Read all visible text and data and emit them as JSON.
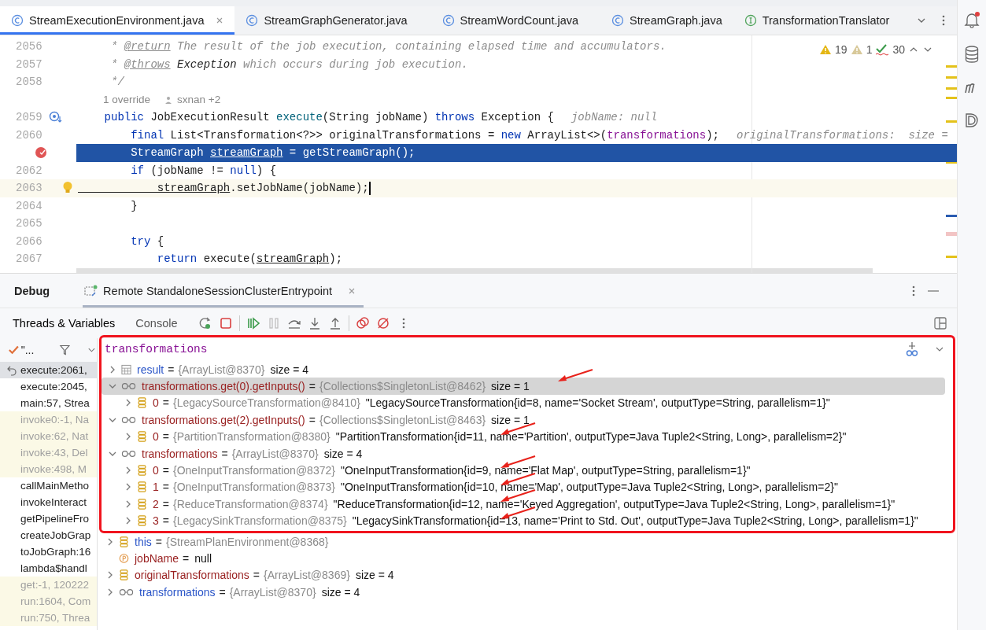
{
  "editor_tabs": [
    {
      "label": "StreamExecutionEnvironment.java",
      "kind": "class",
      "selected": true
    },
    {
      "label": "StreamGraphGenerator.java",
      "kind": "class",
      "selected": false
    },
    {
      "label": "StreamWordCount.java",
      "kind": "class",
      "selected": false
    },
    {
      "label": "StreamGraph.java",
      "kind": "class",
      "selected": false
    },
    {
      "label": "TransformationTranslator",
      "kind": "interface",
      "selected": false
    }
  ],
  "inspections": {
    "warnings": "19",
    "weak_warnings": "1",
    "typos": "30"
  },
  "editor_lines": [
    {
      "number": "2056",
      "segments": [
        {
          "kind": "comment",
          "text": "     * "
        },
        {
          "kind": "doctag",
          "text": "@return"
        },
        {
          "kind": "comment",
          "text": " The result of the job execution, containing elapsed time and accumulators."
        }
      ]
    },
    {
      "number": "2057",
      "segments": [
        {
          "kind": "comment",
          "text": "     * "
        },
        {
          "kind": "doctag",
          "text": "@throws"
        },
        {
          "kind": "italic",
          "text": " Exception"
        },
        {
          "kind": "comment",
          "text": " which occurs during job execution."
        }
      ]
    },
    {
      "number": "2058",
      "segments": [
        {
          "kind": "comment",
          "text": "     */"
        }
      ]
    },
    {
      "kind": "inlay",
      "overrides": "1 override",
      "authors": "sxnan +2"
    },
    {
      "number": "2059",
      "has_override": true,
      "segments": [
        {
          "kind": "kw",
          "text": "    public"
        },
        {
          "kind": "plain",
          "text": " JobExecutionResult "
        },
        {
          "kind": "method",
          "text": "execute"
        },
        {
          "kind": "plain",
          "text": "(String jobName) "
        },
        {
          "kind": "kw",
          "text": "throws"
        },
        {
          "kind": "plain",
          "text": " Exception {"
        }
      ],
      "hint": "jobName: null"
    },
    {
      "number": "2060",
      "segments": [
        {
          "kind": "kw",
          "text": "        final"
        },
        {
          "kind": "plain",
          "text": " List<Transformation<?>> originalTransformations = "
        },
        {
          "kind": "kw",
          "text": "new"
        },
        {
          "kind": "plain",
          "text": " ArrayList<>("
        },
        {
          "kind": "field",
          "text": "transformations"
        },
        {
          "kind": "plain",
          "text": ");"
        }
      ],
      "hint": "originalTransformations:  size ="
    },
    {
      "breakpoint": true,
      "current": true,
      "segments": [
        {
          "kind": "plain",
          "text": "        StreamGraph "
        },
        {
          "kind": "ul",
          "text": "streamGraph"
        },
        {
          "kind": "plain",
          "text": " = getStreamGraph();"
        }
      ]
    },
    {
      "number": "2062",
      "segments": [
        {
          "kind": "kw",
          "text": "        if"
        },
        {
          "kind": "plain",
          "text": " (jobName != "
        },
        {
          "kind": "kw",
          "text": "null"
        },
        {
          "kind": "plain",
          "text": ") {"
        }
      ]
    },
    {
      "number": "2063",
      "intention": true,
      "caret": true,
      "segments": [
        {
          "kind": "ul",
          "text": "            streamGraph"
        },
        {
          "kind": "plain",
          "text": ".setJobName(jobName);"
        }
      ]
    },
    {
      "number": "2064",
      "segments": [
        {
          "kind": "plain",
          "text": "        }"
        }
      ]
    },
    {
      "number": "2065"
    },
    {
      "number": "2066",
      "segments": [
        {
          "kind": "kw",
          "text": "        try"
        },
        {
          "kind": "plain",
          "text": " {"
        }
      ]
    },
    {
      "number": "2067",
      "segments": [
        {
          "kind": "kw",
          "text": "            return"
        },
        {
          "kind": "plain",
          "text": " execute("
        },
        {
          "kind": "ul",
          "text": "streamGraph"
        },
        {
          "kind": "plain",
          "text": ");"
        }
      ]
    }
  ],
  "debug": {
    "title": "Debug",
    "session": "Remote StandaloneSessionClusterEntrypoint",
    "tabs": [
      {
        "label": "Threads & Variables",
        "selected": true
      },
      {
        "label": "Console",
        "selected": false
      }
    ],
    "thread": "\"..."
  },
  "frames": [
    {
      "label": "execute:2061,",
      "library": false,
      "selected": true
    },
    {
      "label": "execute:2045,",
      "library": false,
      "selected": false
    },
    {
      "label": "main:57, Strea",
      "library": false,
      "selected": false
    },
    {
      "label": "invoke0:-1, Na",
      "library": true,
      "selected": false
    },
    {
      "label": "invoke:62, Nat",
      "library": true,
      "selected": false
    },
    {
      "label": "invoke:43, Del",
      "library": true,
      "selected": false
    },
    {
      "label": "invoke:498, M",
      "library": true,
      "selected": false
    },
    {
      "label": "callMainMetho",
      "library": false,
      "selected": false
    },
    {
      "label": "invokeInteract",
      "library": false,
      "selected": false
    },
    {
      "label": "getPipelineFro",
      "library": false,
      "selected": false
    },
    {
      "label": "createJobGrap",
      "library": false,
      "selected": false
    },
    {
      "label": "toJobGraph:16",
      "library": false,
      "selected": false
    },
    {
      "label": "lambda$handl",
      "library": false,
      "selected": false
    },
    {
      "label": "get:-1, 120222",
      "library": true,
      "selected": false
    },
    {
      "label": "run:1604, Com",
      "library": true,
      "selected": false
    },
    {
      "label": "run:750, Threa",
      "library": true,
      "selected": false
    }
  ],
  "watches": {
    "expression": "transformations",
    "outlined": true,
    "items": [
      {
        "name": "result",
        "kind": "result",
        "op": "=",
        "type": "{ArrayList@8370}",
        "value": "size = 4",
        "expanded": false,
        "selected": false,
        "arrow": false
      },
      {
        "name": "transformations.get(0).getInputs()",
        "kind": "watch",
        "op": "=",
        "type": "{Collections$SingletonList@8462}",
        "value": "size = 1",
        "expanded": true,
        "selected": true,
        "arrow": true,
        "children": [
          {
            "name": "0",
            "kind": "element",
            "op": "=",
            "type": "{LegacySourceTransformation@8410}",
            "value": "\"LegacySourceTransformation{id=8, name='Socket Stream', outputType=String, parallelism=1}\"",
            "expanded": false,
            "selected": false,
            "arrow": false
          }
        ]
      },
      {
        "name": "transformations.get(2).getInputs()",
        "kind": "watch",
        "op": "=",
        "type": "{Collections$SingletonList@8463}",
        "value": "size = 1",
        "expanded": true,
        "selected": false,
        "arrow": false,
        "children": [
          {
            "name": "0",
            "kind": "element",
            "op": "=",
            "type": "{PartitionTransformation@8380}",
            "value": "\"PartitionTransformation{id=11, name='Partition', outputType=Java Tuple2<String, Long>, parallelism=2}\"",
            "expanded": false,
            "selected": false,
            "arrow": true
          }
        ]
      },
      {
        "name": "transformations",
        "kind": "watch",
        "op": "=",
        "type": "{ArrayList@8370}",
        "value": "size = 4",
        "expanded": true,
        "selected": false,
        "arrow": false,
        "children": [
          {
            "name": "0",
            "kind": "element",
            "op": "=",
            "type": "{OneInputTransformation@8372}",
            "value": "\"OneInputTransformation{id=9, name='Flat Map', outputType=String, parallelism=1}\"",
            "expanded": false,
            "selected": false,
            "arrow": true
          },
          {
            "name": "1",
            "kind": "element",
            "op": "=",
            "type": "{OneInputTransformation@8373}",
            "value": "\"OneInputTransformation{id=10, name='Map', outputType=Java Tuple2<String, Long>, parallelism=2}\"",
            "expanded": false,
            "selected": false,
            "arrow": true
          },
          {
            "name": "2",
            "kind": "element",
            "op": "=",
            "type": "{ReduceTransformation@8374}",
            "value": "\"ReduceTransformation{id=12, name='Keyed Aggregation', outputType=Java Tuple2<String, Long>, parallelism=1}\"",
            "expanded": false,
            "selected": false,
            "arrow": true
          },
          {
            "name": "3",
            "kind": "element",
            "op": "=",
            "type": "{LegacySinkTransformation@8375}",
            "value": "\"LegacySinkTransformation{id=13, name='Print to Std. Out', outputType=Java Tuple2<String, Long>, parallelism=1}\"",
            "expanded": false,
            "selected": false,
            "arrow": true
          }
        ]
      }
    ]
  },
  "variables": [
    {
      "name": "this",
      "kind": "object",
      "op": "=",
      "type": "{StreamPlanEnvironment@8368}",
      "expandable": true
    },
    {
      "name": "jobName",
      "kind": "parameter",
      "op": "=",
      "value": "null",
      "expandable": false
    },
    {
      "name": "originalTransformations",
      "kind": "local",
      "op": "=",
      "type": "{ArrayList@8369}",
      "value": "size = 4",
      "expandable": true
    },
    {
      "name": "transformations",
      "kind": "field",
      "op": "=",
      "type": "{ArrayList@8370}",
      "value": "size = 4",
      "expandable": true
    }
  ]
}
